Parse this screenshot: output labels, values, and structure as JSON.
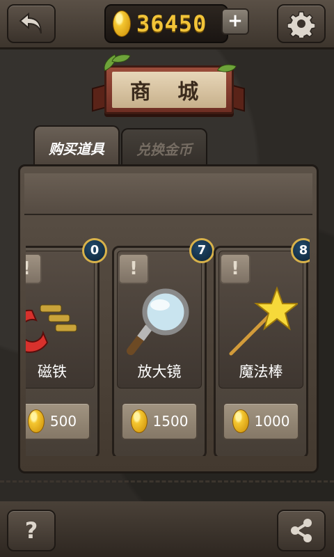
{
  "topbar": {
    "back_icon": "back-arrow-icon",
    "coins": "36450",
    "plus_label": "+",
    "settings_icon": "gear-icon"
  },
  "banner": {
    "title": "商 城"
  },
  "tabs": [
    {
      "label": "购买道具",
      "active": true
    },
    {
      "label": "兑换金币",
      "active": false
    }
  ],
  "items": [
    {
      "name": "磁铁",
      "count": "0",
      "price": "500",
      "info": "!",
      "icon": "magnet-icon"
    },
    {
      "name": "放大镜",
      "count": "7",
      "price": "1500",
      "info": "!",
      "icon": "magnifier-icon"
    },
    {
      "name": "魔法棒",
      "count": "8",
      "price": "1000",
      "info": "!",
      "icon": "magic-wand-icon"
    }
  ],
  "bottombar": {
    "help_label": "?",
    "share_icon": "share-icon"
  },
  "colors": {
    "coin_gold": "#f2c438",
    "badge_blue": "#0d2234",
    "banner_red": "#7a3628"
  }
}
